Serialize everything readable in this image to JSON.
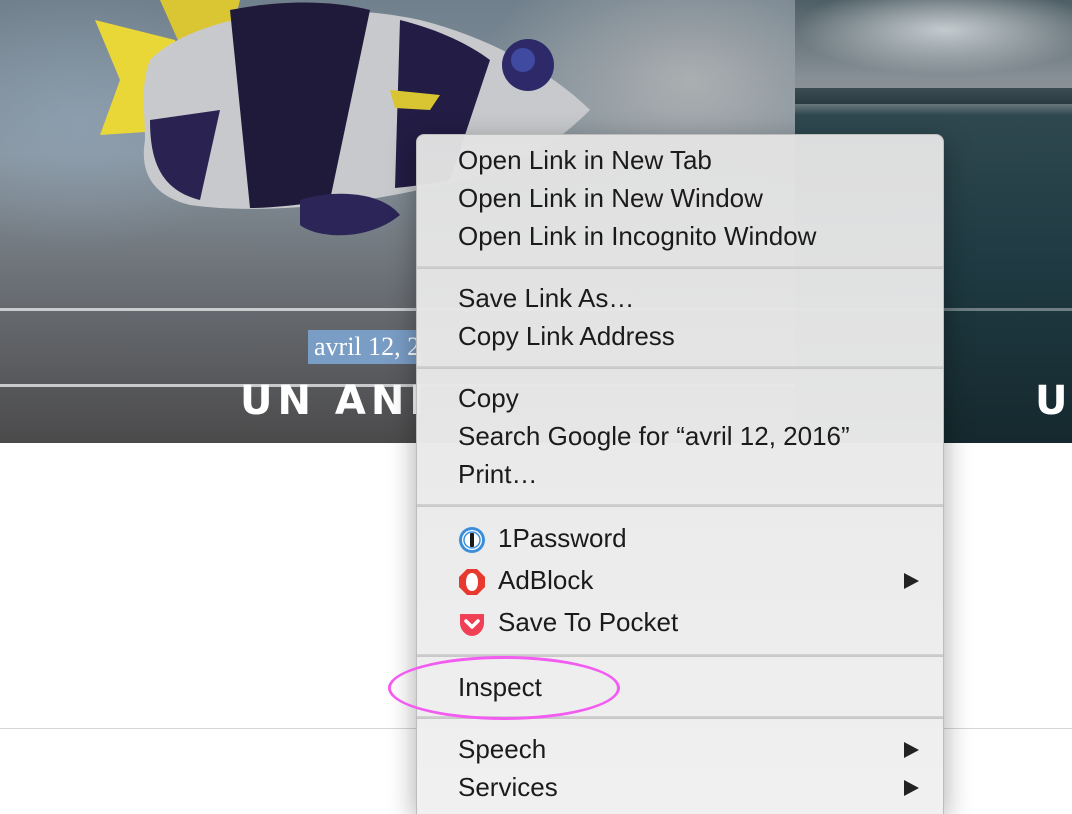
{
  "page": {
    "date_text": "avril 12, 2",
    "article_title": "UN ANI",
    "article_title_right": "U"
  },
  "context_menu": {
    "groups": [
      {
        "items": [
          {
            "label": "Open Link in New Tab"
          },
          {
            "label": "Open Link in New Window"
          },
          {
            "label": "Open Link in Incognito Window"
          }
        ]
      },
      {
        "items": [
          {
            "label": "Save Link As…"
          },
          {
            "label": "Copy Link Address"
          }
        ]
      },
      {
        "items": [
          {
            "label": "Copy"
          },
          {
            "label": "Search Google for “avril 12, 2016”"
          },
          {
            "label": "Print…"
          }
        ]
      },
      {
        "items": [
          {
            "label": "1Password",
            "icon": "1password-icon"
          },
          {
            "label": "AdBlock",
            "icon": "adblock-icon",
            "submenu": true
          },
          {
            "label": "Save To Pocket",
            "icon": "pocket-icon"
          }
        ]
      },
      {
        "items": [
          {
            "label": "Inspect",
            "highlighted": true
          }
        ]
      },
      {
        "items": [
          {
            "label": "Speech",
            "submenu": true
          },
          {
            "label": "Services",
            "submenu": true
          }
        ]
      }
    ]
  },
  "annotation": {
    "color": "#f25cf0"
  }
}
